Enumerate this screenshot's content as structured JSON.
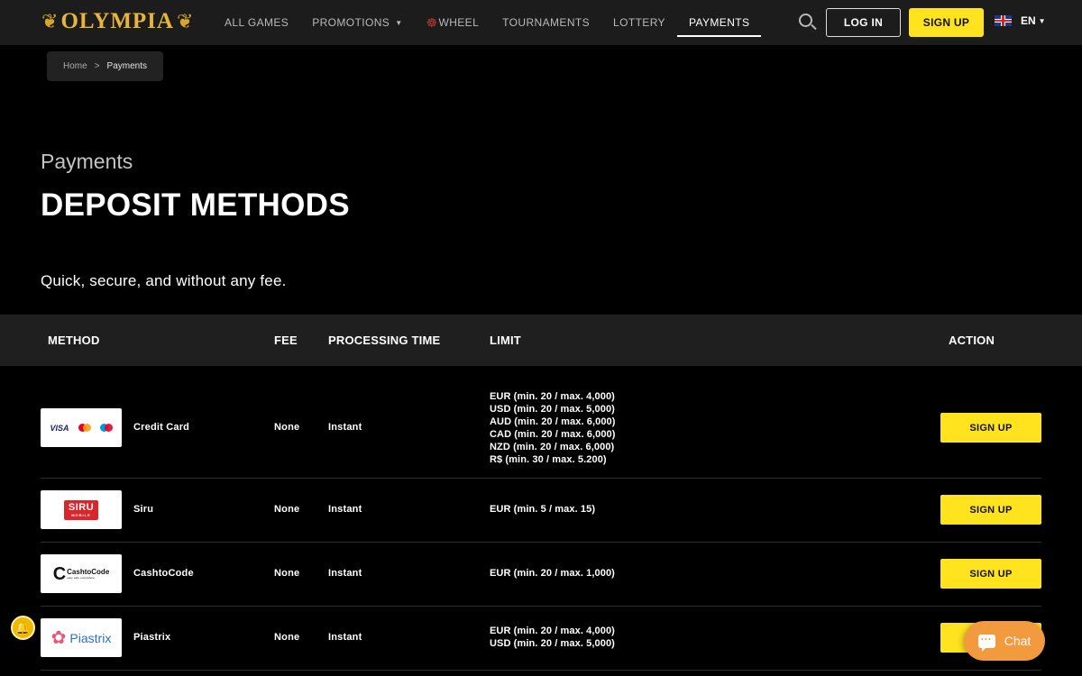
{
  "header": {
    "logo_text": "OLYMPIA",
    "nav": [
      {
        "label": "ALL GAMES"
      },
      {
        "label": "PROMOTIONS"
      },
      {
        "label": "WHEEL"
      },
      {
        "label": "TOURNAMENTS"
      },
      {
        "label": "LOTTERY"
      },
      {
        "label": "PAYMENTS",
        "active": true
      }
    ],
    "login_label": "LOG IN",
    "signup_label": "SIGN UP",
    "language": "EN"
  },
  "breadcrumb": {
    "home": "Home",
    "current": "Payments"
  },
  "page": {
    "eyebrow": "Payments",
    "title": "DEPOSIT METHODS",
    "subtitle": "Quick, secure, and without any fee."
  },
  "table": {
    "headers": {
      "method": "METHOD",
      "fee": "FEE",
      "processing_time": "PROCESSING TIME",
      "limit": "LIMIT",
      "action": "ACTION"
    },
    "rows": [
      {
        "method": "Credit Card",
        "logo": "visa-mastercard-maestro-logo",
        "fee": "None",
        "processing_time": "Instant",
        "limits": [
          "EUR (min. 20 / max. 4,000)",
          "USD (min. 20 / max. 5,000)",
          "AUD (min. 20 / max. 6,000)",
          "CAD (min. 20 / max. 6,000)",
          "NZD (min. 20 / max. 6,000)",
          "R$ (min. 30 / max. 5.200)"
        ],
        "action": "SIGN UP"
      },
      {
        "method": "Siru",
        "logo": "siru-mobile-logo",
        "logo_text": "SIRU",
        "logo_subtext": "MOBILE",
        "fee": "None",
        "processing_time": "Instant",
        "limits": [
          "EUR (min. 5 / max. 15)"
        ],
        "action": "SIGN UP"
      },
      {
        "method": "CashtoCode",
        "logo": "cashtocode-logo",
        "logo_text": "CashtoCode",
        "logo_subtext": "easy, safe, everywhere",
        "fee": "None",
        "processing_time": "Instant",
        "limits": [
          "EUR (min. 20 / max. 1,000)"
        ],
        "action": "SIGN UP"
      },
      {
        "method": "Piastrix",
        "logo": "piastrix-logo",
        "logo_text": "Piastrix",
        "fee": "None",
        "processing_time": "Instant",
        "limits": [
          "EUR (min. 20 / max. 4,000)",
          "USD (min. 20 / max. 5,000)"
        ],
        "action": "SIGN UP"
      }
    ]
  },
  "chat": {
    "label": "Chat"
  },
  "colors": {
    "accent_yellow": "#ffe31e",
    "brand_gold": "#e8b53a",
    "header_bg": "#1c1c1c",
    "chat_orange": "#f19a3e"
  }
}
